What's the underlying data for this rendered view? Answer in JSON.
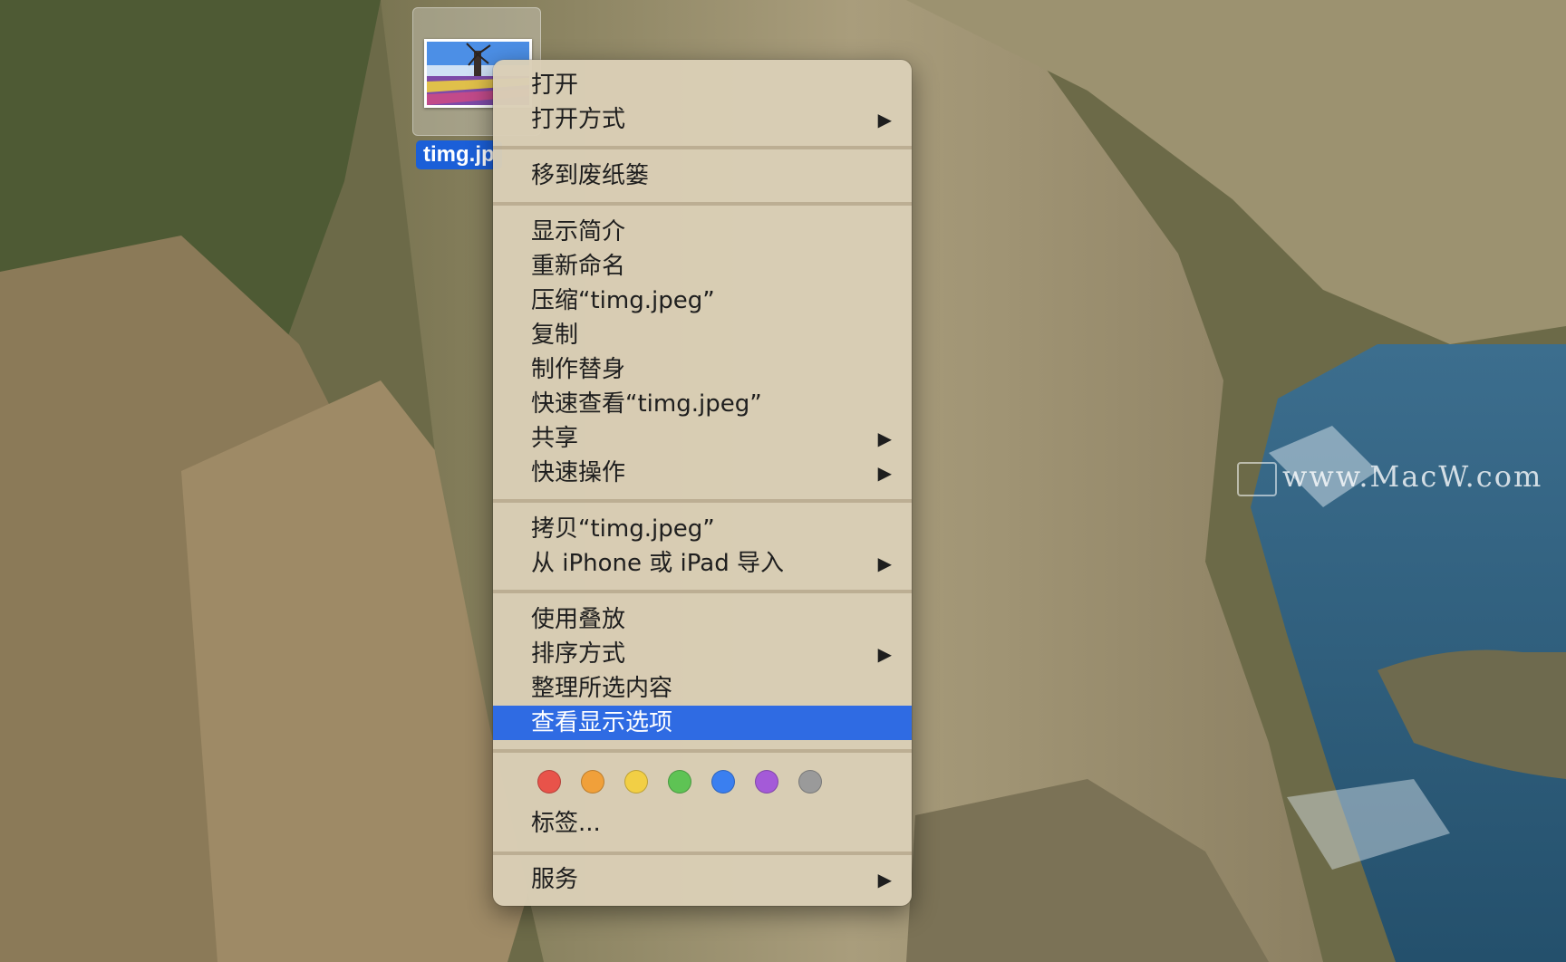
{
  "desktop": {
    "file": {
      "name": "timg.jp"
    },
    "watermark": "www.MacW.com"
  },
  "menu": {
    "items": {
      "open": "打开",
      "open_with": "打开方式",
      "move_to_trash": "移到废纸篓",
      "get_info": "显示简介",
      "rename": "重新命名",
      "compress": "压缩“timg.jpeg”",
      "duplicate": "复制",
      "make_alias": "制作替身",
      "quick_look": "快速查看“timg.jpeg”",
      "share": "共享",
      "quick_actions": "快速操作",
      "copy": "拷贝“timg.jpeg”",
      "import_from_iphone": "从 iPhone 或 iPad 导入",
      "use_stacks": "使用叠放",
      "sort_by": "排序方式",
      "clean_up_selection": "整理所选内容",
      "show_view_options": "查看显示选项",
      "tags": "标签...",
      "services": "服务"
    },
    "submenu_arrow": "▶",
    "tag_colors": [
      "#e8534a",
      "#f0a03a",
      "#f2cf45",
      "#5ec354",
      "#3a7ff0",
      "#a45ad8",
      "#9a9a9a"
    ],
    "highlight_color": "#2f6be3"
  }
}
